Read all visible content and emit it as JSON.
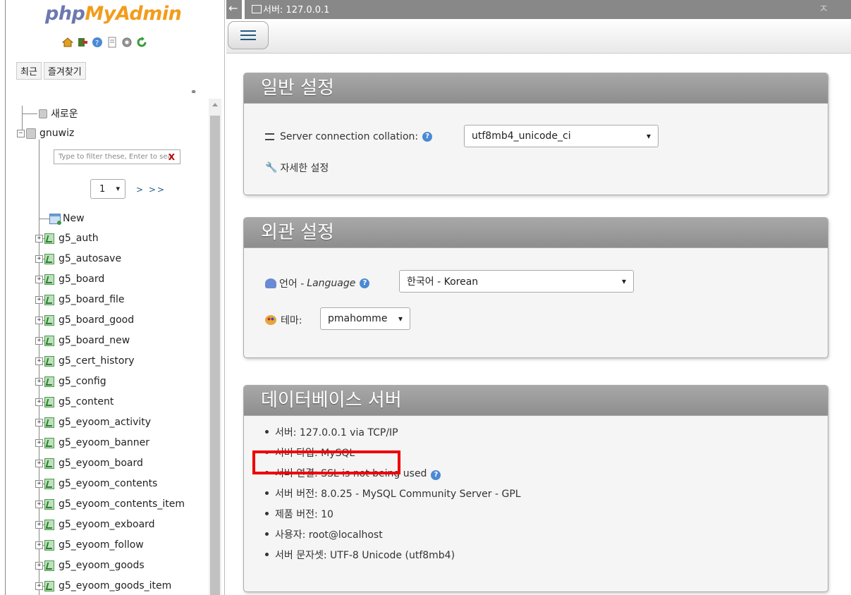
{
  "nav": {
    "logo_php": "php",
    "logo_myadmin": "MyAdmin",
    "icons": [
      "home-icon",
      "logout-icon",
      "help-icon",
      "docs-icon",
      "settings-icon",
      "reload-icon"
    ],
    "tabs": {
      "recent": "최근",
      "favorites": "즐겨찾기"
    },
    "tree_new_db": "새로운",
    "db_name": "gnuwiz",
    "filter_placeholder": "Type to filter these, Enter to search all",
    "filter_clear": "X",
    "page_select": "1",
    "page_next": "> >>",
    "table_new": "New",
    "tables": [
      "g5_auth",
      "g5_autosave",
      "g5_board",
      "g5_board_file",
      "g5_board_good",
      "g5_board_new",
      "g5_cert_history",
      "g5_config",
      "g5_content",
      "g5_eyoom_activity",
      "g5_eyoom_banner",
      "g5_eyoom_board",
      "g5_eyoom_contents",
      "g5_eyoom_contents_item",
      "g5_eyoom_exboard",
      "g5_eyoom_follow",
      "g5_eyoom_goods",
      "g5_eyoom_goods_item"
    ]
  },
  "topbar": {
    "back": "←",
    "server": "서버: 127.0.0.1",
    "collapse": "ㅈ"
  },
  "general": {
    "title": "일반 설정",
    "collation_label": "Server connection collation:",
    "collation_value": "utf8mb4_unicode_ci",
    "more_settings": "자세한 설정"
  },
  "appearance": {
    "title": "외관 설정",
    "language_label": "언어 - ",
    "language_label_em": "Language",
    "language_value": "한국어 - Korean",
    "theme_label": "테마:",
    "theme_value": "pmahomme"
  },
  "dbserver": {
    "title": "데이터베이스 서버",
    "items": [
      "서버: 127.0.0.1 via TCP/IP",
      "서버 타입: MySQL",
      "서버 연결: SSL is not being used",
      "서버 버전: 8.0.25 - MySQL Community Server - GPL",
      "제품 버전: 10",
      "사용자: root@localhost",
      "서버 문자셋: UTF-8 Unicode (utf8mb4)"
    ]
  },
  "colors": {
    "highlight": "#e00000",
    "panel_header": "#999999",
    "link": "#235a81"
  }
}
